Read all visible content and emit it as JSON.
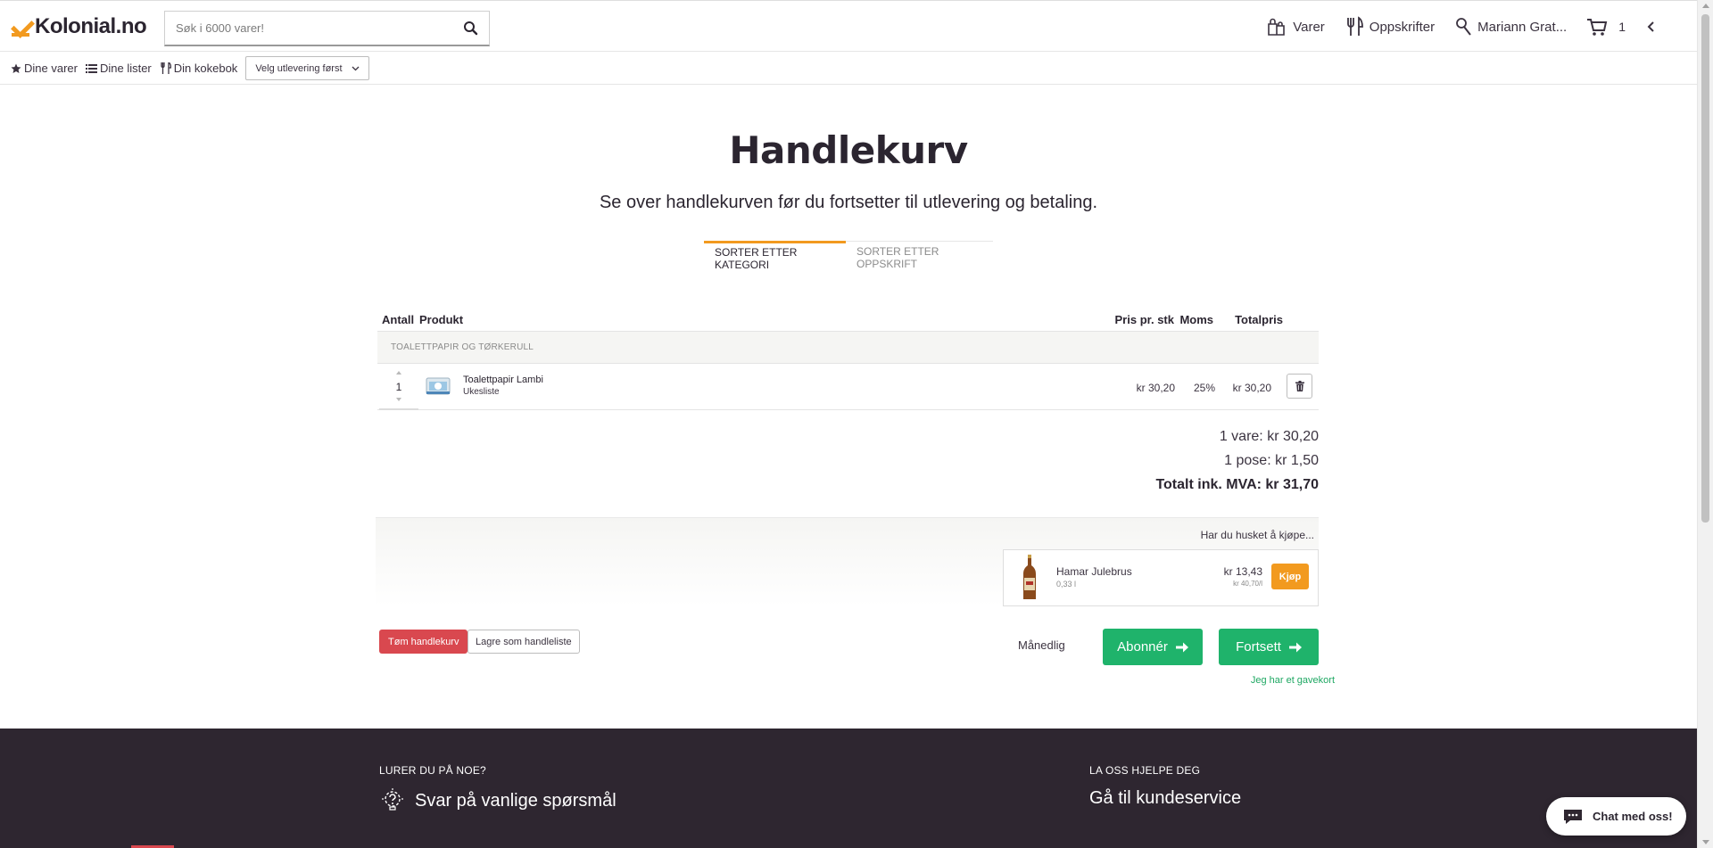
{
  "header": {
    "logo_text": "Kolonial.no",
    "search_placeholder": "Søk i 6000 varer!",
    "nav": {
      "products": "Varer",
      "recipes": "Oppskrifter",
      "user": "Mariann Grat...",
      "cart_count": "1"
    }
  },
  "subnav": {
    "my_products": "Dine varer",
    "my_lists": "Dine lister",
    "my_cookbook": "Din kokebok",
    "delivery_select": "Velg utlevering først"
  },
  "page": {
    "title": "Handlekurv",
    "subtitle": "Se over handlekurven før du fortsetter til utlevering og betaling.",
    "tabs": [
      {
        "label": "SORTER ETTER KATEGORI",
        "active": true
      },
      {
        "label": "SORTER ETTER OPPSKRIFT",
        "active": false
      }
    ]
  },
  "cart": {
    "columns": {
      "quantity": "Antall",
      "product": "Produkt",
      "unit_price": "Pris pr. stk",
      "vat": "Moms",
      "total": "Totalpris"
    },
    "categories": [
      {
        "name": "TOALETTPAPIR OG TØRKERULL",
        "items": [
          {
            "quantity": "1",
            "name": "Toalettpapir Lambi",
            "list": "Ukesliste",
            "unit_price": "kr 30,20",
            "vat": "25%",
            "total": "kr 30,20"
          }
        ]
      }
    ],
    "summary": {
      "items": "1 vare: kr 30,20",
      "bags": "1 pose: kr 1,50",
      "total": "Totalt ink. MVA: kr 31,70"
    }
  },
  "upsell": {
    "title": "Har du husket å kjøpe...",
    "product": {
      "name": "Hamar Julebrus",
      "volume": "0,33 l",
      "price": "kr 13,43",
      "unit_price": "kr 40,70/l",
      "buy_label": "Kjøp"
    }
  },
  "actions": {
    "empty_cart": "Tøm handlekurv",
    "save_list": "Lagre som handleliste",
    "monthly": "Månedlig",
    "subscribe": "Abonnér",
    "continue": "Fortsett",
    "gift_card": "Jeg har et gavekort"
  },
  "footer": {
    "left_small": "LURER DU PÅ NOE?",
    "left_big": "Svar på vanlige spørsmål",
    "right_small": "LA OSS HJELPE DEG",
    "right_big": "Gå til kundeservice"
  },
  "chat": {
    "label": "Chat med oss!"
  },
  "colors": {
    "brand_orange": "#f29a1f",
    "green": "#1fb36b",
    "red": "#d9484f",
    "footer_bg": "#2e2630"
  }
}
